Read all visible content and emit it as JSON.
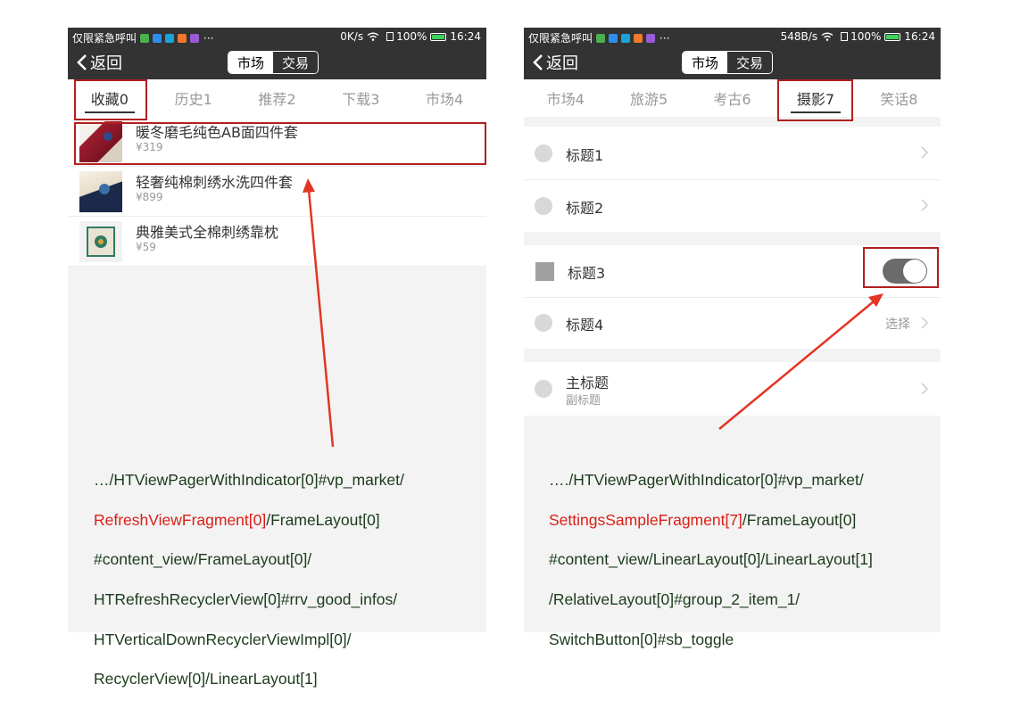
{
  "left_screen": {
    "status_bar": {
      "carrier": "仅限紧急呼叫",
      "dots": "···",
      "speed": "0K/s",
      "battery": "100%",
      "time": "16:24"
    },
    "title_bar": {
      "back_label": "返回",
      "segments": [
        "市场",
        "交易"
      ]
    },
    "tabs": [
      "收藏0",
      "历史1",
      "推荐2",
      "下载3",
      "市场4"
    ],
    "goods": [
      {
        "name": "暖冬磨毛纯色AB面四件套",
        "price": "¥319",
        "thumb_color": "#9c1c2e"
      },
      {
        "name": "轻奢纯棉刺绣水洗四件套",
        "price": "¥899",
        "thumb_color": "#e8dcc8"
      },
      {
        "name": "典雅美式全棉刺绣靠枕",
        "price": "¥59",
        "thumb_color": "#2f7a62"
      }
    ]
  },
  "right_screen": {
    "status_bar": {
      "carrier": "仅限紧急呼叫",
      "dots": "···",
      "speed": "548B/s",
      "battery": "100%",
      "time": "16:24"
    },
    "title_bar": {
      "back_label": "返回",
      "segments": [
        "市场",
        "交易"
      ]
    },
    "tabs": [
      "市场4",
      "旅游5",
      "考古6",
      "摄影7",
      "笑话8"
    ],
    "settings": [
      {
        "title": "标题1"
      },
      {
        "title": "标题2"
      },
      {
        "title": "标题3",
        "switch_on": true
      },
      {
        "title": "标题4",
        "hint": "选择"
      },
      {
        "title": "主标题",
        "subtitle": "副标题"
      }
    ]
  },
  "annotations": {
    "left": [
      [
        "…/HTViewPagerWithIndicator[0]#vp_market/"
      ],
      [
        "RefreshViewFragment[0]",
        "/FrameLayout[0]"
      ],
      [
        "#content_view/FrameLayout[0]/"
      ],
      [
        "HTRefreshRecyclerView[0]#rrv_good_infos/"
      ],
      [
        "HTVerticalDownRecyclerViewImpl[0]/"
      ],
      [
        "RecyclerView[0]/LinearLayout[1]"
      ]
    ],
    "right": [
      [
        "…./HTViewPagerWithIndicator[0]#vp_market/"
      ],
      [
        "SettingsSampleFragment[7]",
        "/FrameLayout[0]"
      ],
      [
        "#content_view/LinearLayout[0]/LinearLayout[1]"
      ],
      [
        "/RelativeLayout[0]#group_2_item_1/"
      ],
      [
        "SwitchButton[0]#sb_toggle"
      ]
    ]
  },
  "colors": {
    "bar": "#333333",
    "highlight_box": "#b0201f",
    "arrow": "#e33524",
    "annotation_text": "#1c3b1c",
    "annotation_highlight": "#d91f16",
    "toggle_on": "#6b6b6b"
  }
}
